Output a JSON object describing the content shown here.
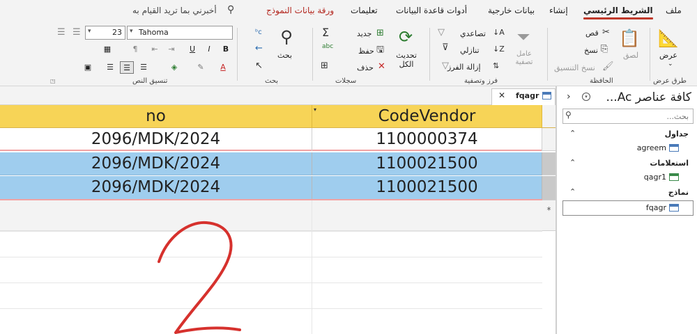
{
  "tabs": [
    {
      "key": "file",
      "label": "ملف"
    },
    {
      "key": "home",
      "label": "الشريط الرئيسي"
    },
    {
      "key": "create",
      "label": "إنشاء"
    },
    {
      "key": "external",
      "label": "بيانات خارجية"
    },
    {
      "key": "dbtools",
      "label": "أدوات قاعدة البيانات"
    },
    {
      "key": "help",
      "label": "تعليمات"
    },
    {
      "key": "formsheet",
      "label": "ورقة بيانات النموذج"
    }
  ],
  "tell_me": "أخبرني بما تريد القيام به",
  "ribbon": {
    "views": {
      "view_label": "عرض",
      "group_label": "طرق عرض"
    },
    "clipboard": {
      "paste_label": "لصق",
      "cut_label": "قص",
      "copy_label": "نسخ",
      "format_painter_label": "نسخ التنسيق",
      "group_label": "الحافظة"
    },
    "sort_filter": {
      "filter_label": "عامل تصفية",
      "ascending_label": "تصاعدي",
      "descending_label": "تنازلي",
      "remove_sort_label": "إزالة الفرز",
      "group_label": "فرز وتصفية"
    },
    "records": {
      "refresh_label": "تحديث الكل",
      "new_label": "جديد",
      "save_label": "حفظ",
      "delete_label": "حذف",
      "group_label": "سجلات"
    },
    "find": {
      "find_label": "بحث",
      "group_label": "بحث"
    },
    "text_formatting": {
      "font_name": "Tahoma",
      "font_size": "23",
      "bold": "B",
      "italic": "I",
      "underline": "U",
      "group_label": "تنسيق النص"
    }
  },
  "document_tab": {
    "label": "fqagr"
  },
  "datasheet": {
    "columns": [
      "no",
      "CodeVendor"
    ],
    "rows": [
      {
        "no": "2096/MDK/2024",
        "code": "1100000374"
      },
      {
        "no": "2096/MDK/2024",
        "code": "1100021500"
      },
      {
        "no": "2096/MDK/2024",
        "code": "1100021500"
      }
    ],
    "new_record_marker": "*"
  },
  "nav_pane": {
    "title": "كافة عناصر Ac...",
    "search_placeholder": "بحث...",
    "groups": [
      {
        "label": "جداول",
        "items": [
          "agreem"
        ]
      },
      {
        "label": "استعلامات",
        "items": [
          "qagr1"
        ]
      },
      {
        "label": "نماذج",
        "items": [
          "fqagr"
        ]
      }
    ]
  },
  "annotation": {
    "handwritten_digit": "2"
  },
  "colors": {
    "header": "#f7d457",
    "selected_row": "#9fcdee",
    "active_tab_underline": "#c0392b",
    "form_tab_text": "#b3261e"
  }
}
